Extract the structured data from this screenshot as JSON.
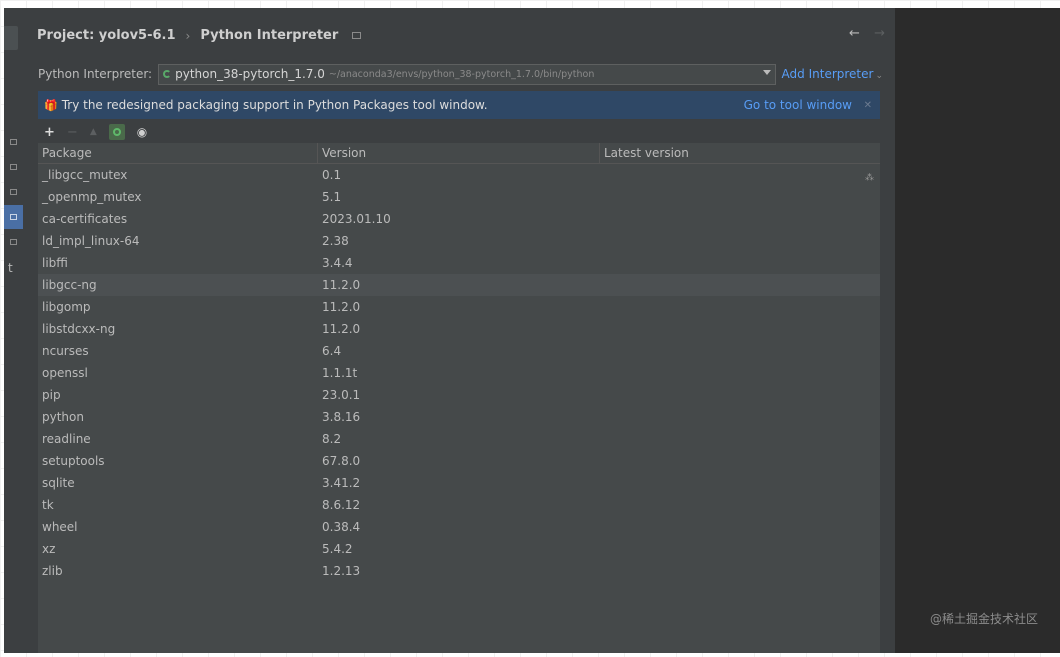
{
  "breadcrumb": {
    "project": "Project: yolov5-6.1",
    "separator": "›",
    "section": "Python Interpreter"
  },
  "nav": {
    "back": "←",
    "forward": "→"
  },
  "interpreter": {
    "label": "Python Interpreter:",
    "name": "python_38-pytorch_1.7.0",
    "path": "~/anaconda3/envs/python_38-pytorch_1.7.0/bin/python",
    "add_label": "Add Interpreter"
  },
  "banner": {
    "message": "Try the redesigned packaging support in Python Packages tool window.",
    "link": "Go to tool window"
  },
  "table": {
    "headers": [
      "Package",
      "Version",
      "Latest version"
    ],
    "rows": [
      {
        "package": "_libgcc_mutex",
        "version": "0.1"
      },
      {
        "package": "_openmp_mutex",
        "version": "5.1"
      },
      {
        "package": "ca-certificates",
        "version": "2023.01.10"
      },
      {
        "package": "ld_impl_linux-64",
        "version": "2.38"
      },
      {
        "package": "libffi",
        "version": "3.4.4"
      },
      {
        "package": "libgcc-ng",
        "version": "11.2.0"
      },
      {
        "package": "libgomp",
        "version": "11.2.0"
      },
      {
        "package": "libstdcxx-ng",
        "version": "11.2.0"
      },
      {
        "package": "ncurses",
        "version": "6.4"
      },
      {
        "package": "openssl",
        "version": "1.1.1t"
      },
      {
        "package": "pip",
        "version": "23.0.1"
      },
      {
        "package": "python",
        "version": "3.8.16"
      },
      {
        "package": "readline",
        "version": "8.2"
      },
      {
        "package": "setuptools",
        "version": "67.8.0"
      },
      {
        "package": "sqlite",
        "version": "3.41.2"
      },
      {
        "package": "tk",
        "version": "8.6.12"
      },
      {
        "package": "wheel",
        "version": "0.38.4"
      },
      {
        "package": "xz",
        "version": "5.4.2"
      },
      {
        "package": "zlib",
        "version": "1.2.13"
      }
    ],
    "selected_row": 5
  },
  "left_strip": {
    "char": "t"
  },
  "watermark": "@稀土掘金技术社区",
  "colors": {
    "background": "#3c3f41",
    "table_background": "#45494a",
    "banner": "#2f4866",
    "link": "#589df6",
    "selected_row": "#4c5052"
  }
}
